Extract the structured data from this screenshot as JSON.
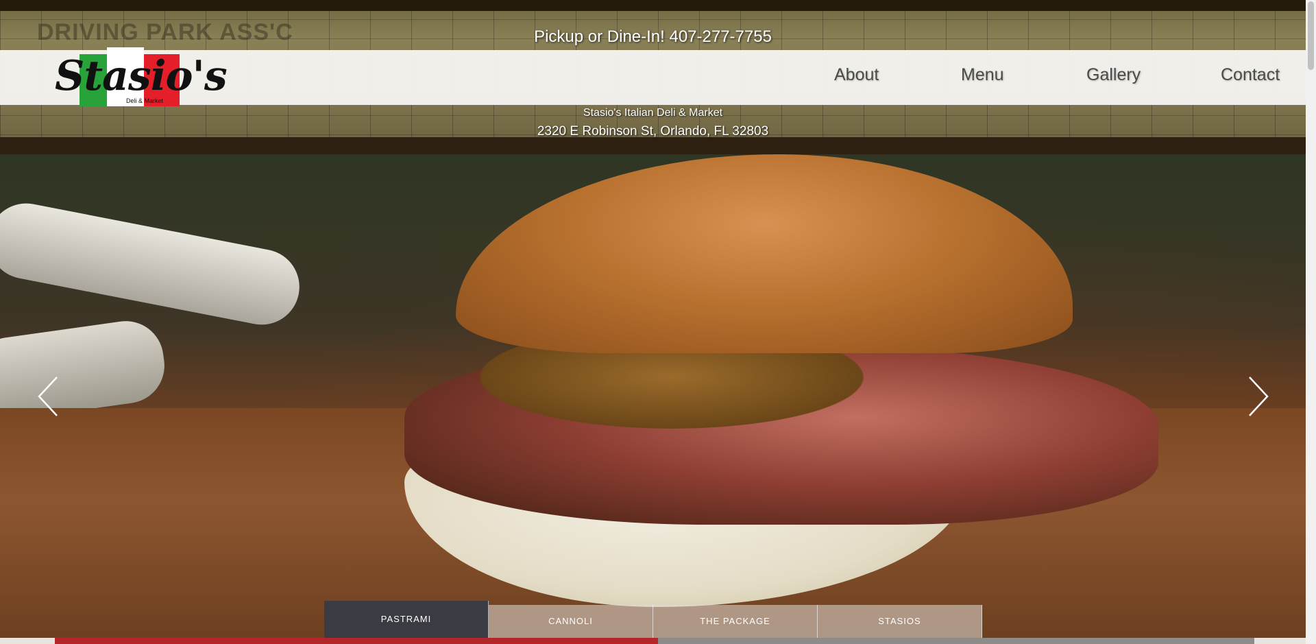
{
  "header": {
    "phone_line": "Pickup or Dine-In! 407-277-7755",
    "business_name": "Stasio's Italian Deli & Market",
    "address": "2320 E Robinson St, Orlando, FL 32803"
  },
  "logo": {
    "script_text": "Stasio's",
    "tagline": "Deli & Market",
    "colors": {
      "green": "#27a339",
      "white": "#ffffff",
      "red": "#e51f2a"
    }
  },
  "map_background": {
    "label": "DRIVING PARK ASS'C"
  },
  "nav": {
    "items": [
      {
        "label": "About"
      },
      {
        "label": "Menu"
      },
      {
        "label": "Gallery"
      },
      {
        "label": "Contact"
      }
    ]
  },
  "slideshow": {
    "prev_icon": "chevron-left-icon",
    "next_icon": "chevron-right-icon",
    "active_index": 0,
    "tabs": [
      {
        "label": "PASTRAMI"
      },
      {
        "label": "CANNOLI"
      },
      {
        "label": "THE PACKAGE"
      },
      {
        "label": "STASIOS"
      }
    ]
  },
  "colors": {
    "active_tab": "#3b3b44",
    "header_bar": "#f5f4f0",
    "nav_text": "#4a4a4a"
  }
}
